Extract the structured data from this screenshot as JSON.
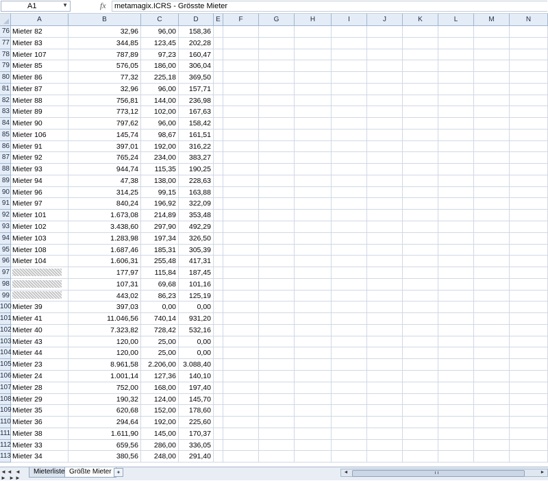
{
  "formula_bar": {
    "cell_ref": "A1",
    "fx_label": "fx",
    "content": "metamagix.ICRS - Grösste Mieter"
  },
  "columns": [
    "A",
    "B",
    "C",
    "D",
    "E",
    "F",
    "G",
    "H",
    "I",
    "J",
    "K",
    "L",
    "M",
    "N"
  ],
  "rows": [
    {
      "n": "76",
      "a": "Mieter 82",
      "b": "32,96",
      "c": "96,00",
      "d": "158,36"
    },
    {
      "n": "77",
      "a": "Mieter 83",
      "b": "344,85",
      "c": "123,45",
      "d": "202,28"
    },
    {
      "n": "78",
      "a": "Mieter 107",
      "b": "787,89",
      "c": "97,23",
      "d": "160,47"
    },
    {
      "n": "79",
      "a": "Mieter 85",
      "b": "576,05",
      "c": "186,00",
      "d": "306,04"
    },
    {
      "n": "80",
      "a": "Mieter 86",
      "b": "77,32",
      "c": "225,18",
      "d": "369,50"
    },
    {
      "n": "81",
      "a": "Mieter 87",
      "b": "32,96",
      "c": "96,00",
      "d": "157,71"
    },
    {
      "n": "82",
      "a": "Mieter 88",
      "b": "756,81",
      "c": "144,00",
      "d": "236,98"
    },
    {
      "n": "83",
      "a": "Mieter 89",
      "b": "773,12",
      "c": "102,00",
      "d": "167,63"
    },
    {
      "n": "84",
      "a": "Mieter 90",
      "b": "797,62",
      "c": "96,00",
      "d": "158,42"
    },
    {
      "n": "85",
      "a": "Mieter 106",
      "b": "145,74",
      "c": "98,67",
      "d": "161,51"
    },
    {
      "n": "86",
      "a": "Mieter 91",
      "b": "397,01",
      "c": "192,00",
      "d": "316,22"
    },
    {
      "n": "87",
      "a": "Mieter 92",
      "b": "765,24",
      "c": "234,00",
      "d": "383,27"
    },
    {
      "n": "88",
      "a": "Mieter 93",
      "b": "944,74",
      "c": "115,35",
      "d": "190,25"
    },
    {
      "n": "89",
      "a": "Mieter 94",
      "b": "47,38",
      "c": "138,00",
      "d": "228,63"
    },
    {
      "n": "90",
      "a": "Mieter 96",
      "b": "314,25",
      "c": "99,15",
      "d": "163,88"
    },
    {
      "n": "91",
      "a": "Mieter 97",
      "b": "840,24",
      "c": "196,92",
      "d": "322,09"
    },
    {
      "n": "92",
      "a": "Mieter 101",
      "b": "1.673,08",
      "c": "214,89",
      "d": "353,48"
    },
    {
      "n": "93",
      "a": "Mieter 102",
      "b": "3.438,60",
      "c": "297,90",
      "d": "492,29"
    },
    {
      "n": "94",
      "a": "Mieter 103",
      "b": "1.283,98",
      "c": "197,34",
      "d": "326,50"
    },
    {
      "n": "95",
      "a": "Mieter 108",
      "b": "1.687,46",
      "c": "185,31",
      "d": "305,39"
    },
    {
      "n": "96",
      "a": "Mieter 104",
      "b": "1.606,31",
      "c": "255,48",
      "d": "417,31"
    },
    {
      "n": "97",
      "a": "",
      "b": "177,97",
      "c": "115,84",
      "d": "187,45",
      "blurred": true
    },
    {
      "n": "98",
      "a": "",
      "b": "107,31",
      "c": "69,68",
      "d": "101,16",
      "blurred": true
    },
    {
      "n": "99",
      "a": "",
      "b": "443,02",
      "c": "86,23",
      "d": "125,19",
      "blurred": true
    },
    {
      "n": "100",
      "a": "Mieter 39",
      "b": "397,03",
      "c": "0,00",
      "d": "0,00"
    },
    {
      "n": "101",
      "a": "Mieter 41",
      "b": "11.046,56",
      "c": "740,14",
      "d": "931,20"
    },
    {
      "n": "102",
      "a": "Mieter 40",
      "b": "7.323,82",
      "c": "728,42",
      "d": "532,16"
    },
    {
      "n": "103",
      "a": "Mieter 43",
      "b": "120,00",
      "c": "25,00",
      "d": "0,00"
    },
    {
      "n": "104",
      "a": "Mieter 44",
      "b": "120,00",
      "c": "25,00",
      "d": "0,00"
    },
    {
      "n": "105",
      "a": "Mieter 23",
      "b": "8.961,58",
      "c": "2.206,00",
      "d": "3.088,40"
    },
    {
      "n": "106",
      "a": "Mieter 24",
      "b": "1.001,14",
      "c": "127,36",
      "d": "140,10"
    },
    {
      "n": "107",
      "a": "Mieter 28",
      "b": "752,00",
      "c": "168,00",
      "d": "197,40"
    },
    {
      "n": "108",
      "a": "Mieter 29",
      "b": "190,32",
      "c": "124,00",
      "d": "145,70"
    },
    {
      "n": "109",
      "a": "Mieter 35",
      "b": "620,68",
      "c": "152,00",
      "d": "178,60"
    },
    {
      "n": "110",
      "a": "Mieter 36",
      "b": "294,64",
      "c": "192,00",
      "d": "225,60"
    },
    {
      "n": "111",
      "a": "Mieter 38",
      "b": "1.611,90",
      "c": "145,00",
      "d": "170,37"
    },
    {
      "n": "112",
      "a": "Mieter 33",
      "b": "659,56",
      "c": "286,00",
      "d": "336,05"
    },
    {
      "n": "113",
      "a": "Mieter 34",
      "b": "380,56",
      "c": "248,00",
      "d": "291,40"
    }
  ],
  "sheet_tabs": [
    "Mieterliste",
    "Größte Mieter"
  ],
  "active_tab": "Größte Mieter"
}
